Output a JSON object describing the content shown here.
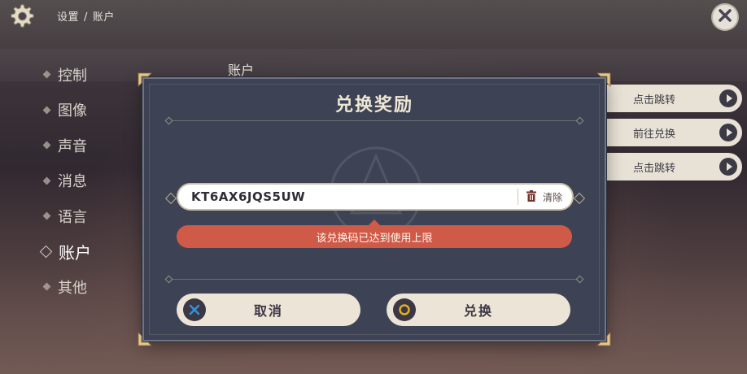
{
  "breadcrumb": {
    "root": "设置",
    "separator": "/",
    "current": "账户"
  },
  "nav": {
    "items": [
      {
        "label": "控制",
        "active": false
      },
      {
        "label": "图像",
        "active": false
      },
      {
        "label": "声音",
        "active": false
      },
      {
        "label": "消息",
        "active": false
      },
      {
        "label": "语言",
        "active": false
      },
      {
        "label": "账户",
        "active": true
      },
      {
        "label": "其他",
        "active": false
      }
    ]
  },
  "section": {
    "label": "账户"
  },
  "side_buttons": [
    {
      "label": "点击跳转"
    },
    {
      "label": "前往兑换"
    },
    {
      "label": "点击跳转"
    }
  ],
  "modal": {
    "title": "兑换奖励",
    "code_input": {
      "value": "KT6AX6JQS5UW"
    },
    "clear_label": "清除",
    "error_message": "该兑换码已达到使用上限",
    "cancel_label": "取消",
    "confirm_label": "兑换"
  },
  "icons": {
    "settings": "gear-icon",
    "close": "close-icon",
    "clear": "trash-icon",
    "cancel_button": "cross-button-icon",
    "confirm_button": "circle-button-icon",
    "side_arrow": "play-arrow-icon"
  },
  "colors": {
    "modal_bg": "#3d4354",
    "error": "#cf5a48",
    "button_bg": "#ece4d6",
    "cancel_accent": "#3a8fd6",
    "confirm_accent": "#e0b020",
    "corner_gold": "#e3c48a"
  }
}
